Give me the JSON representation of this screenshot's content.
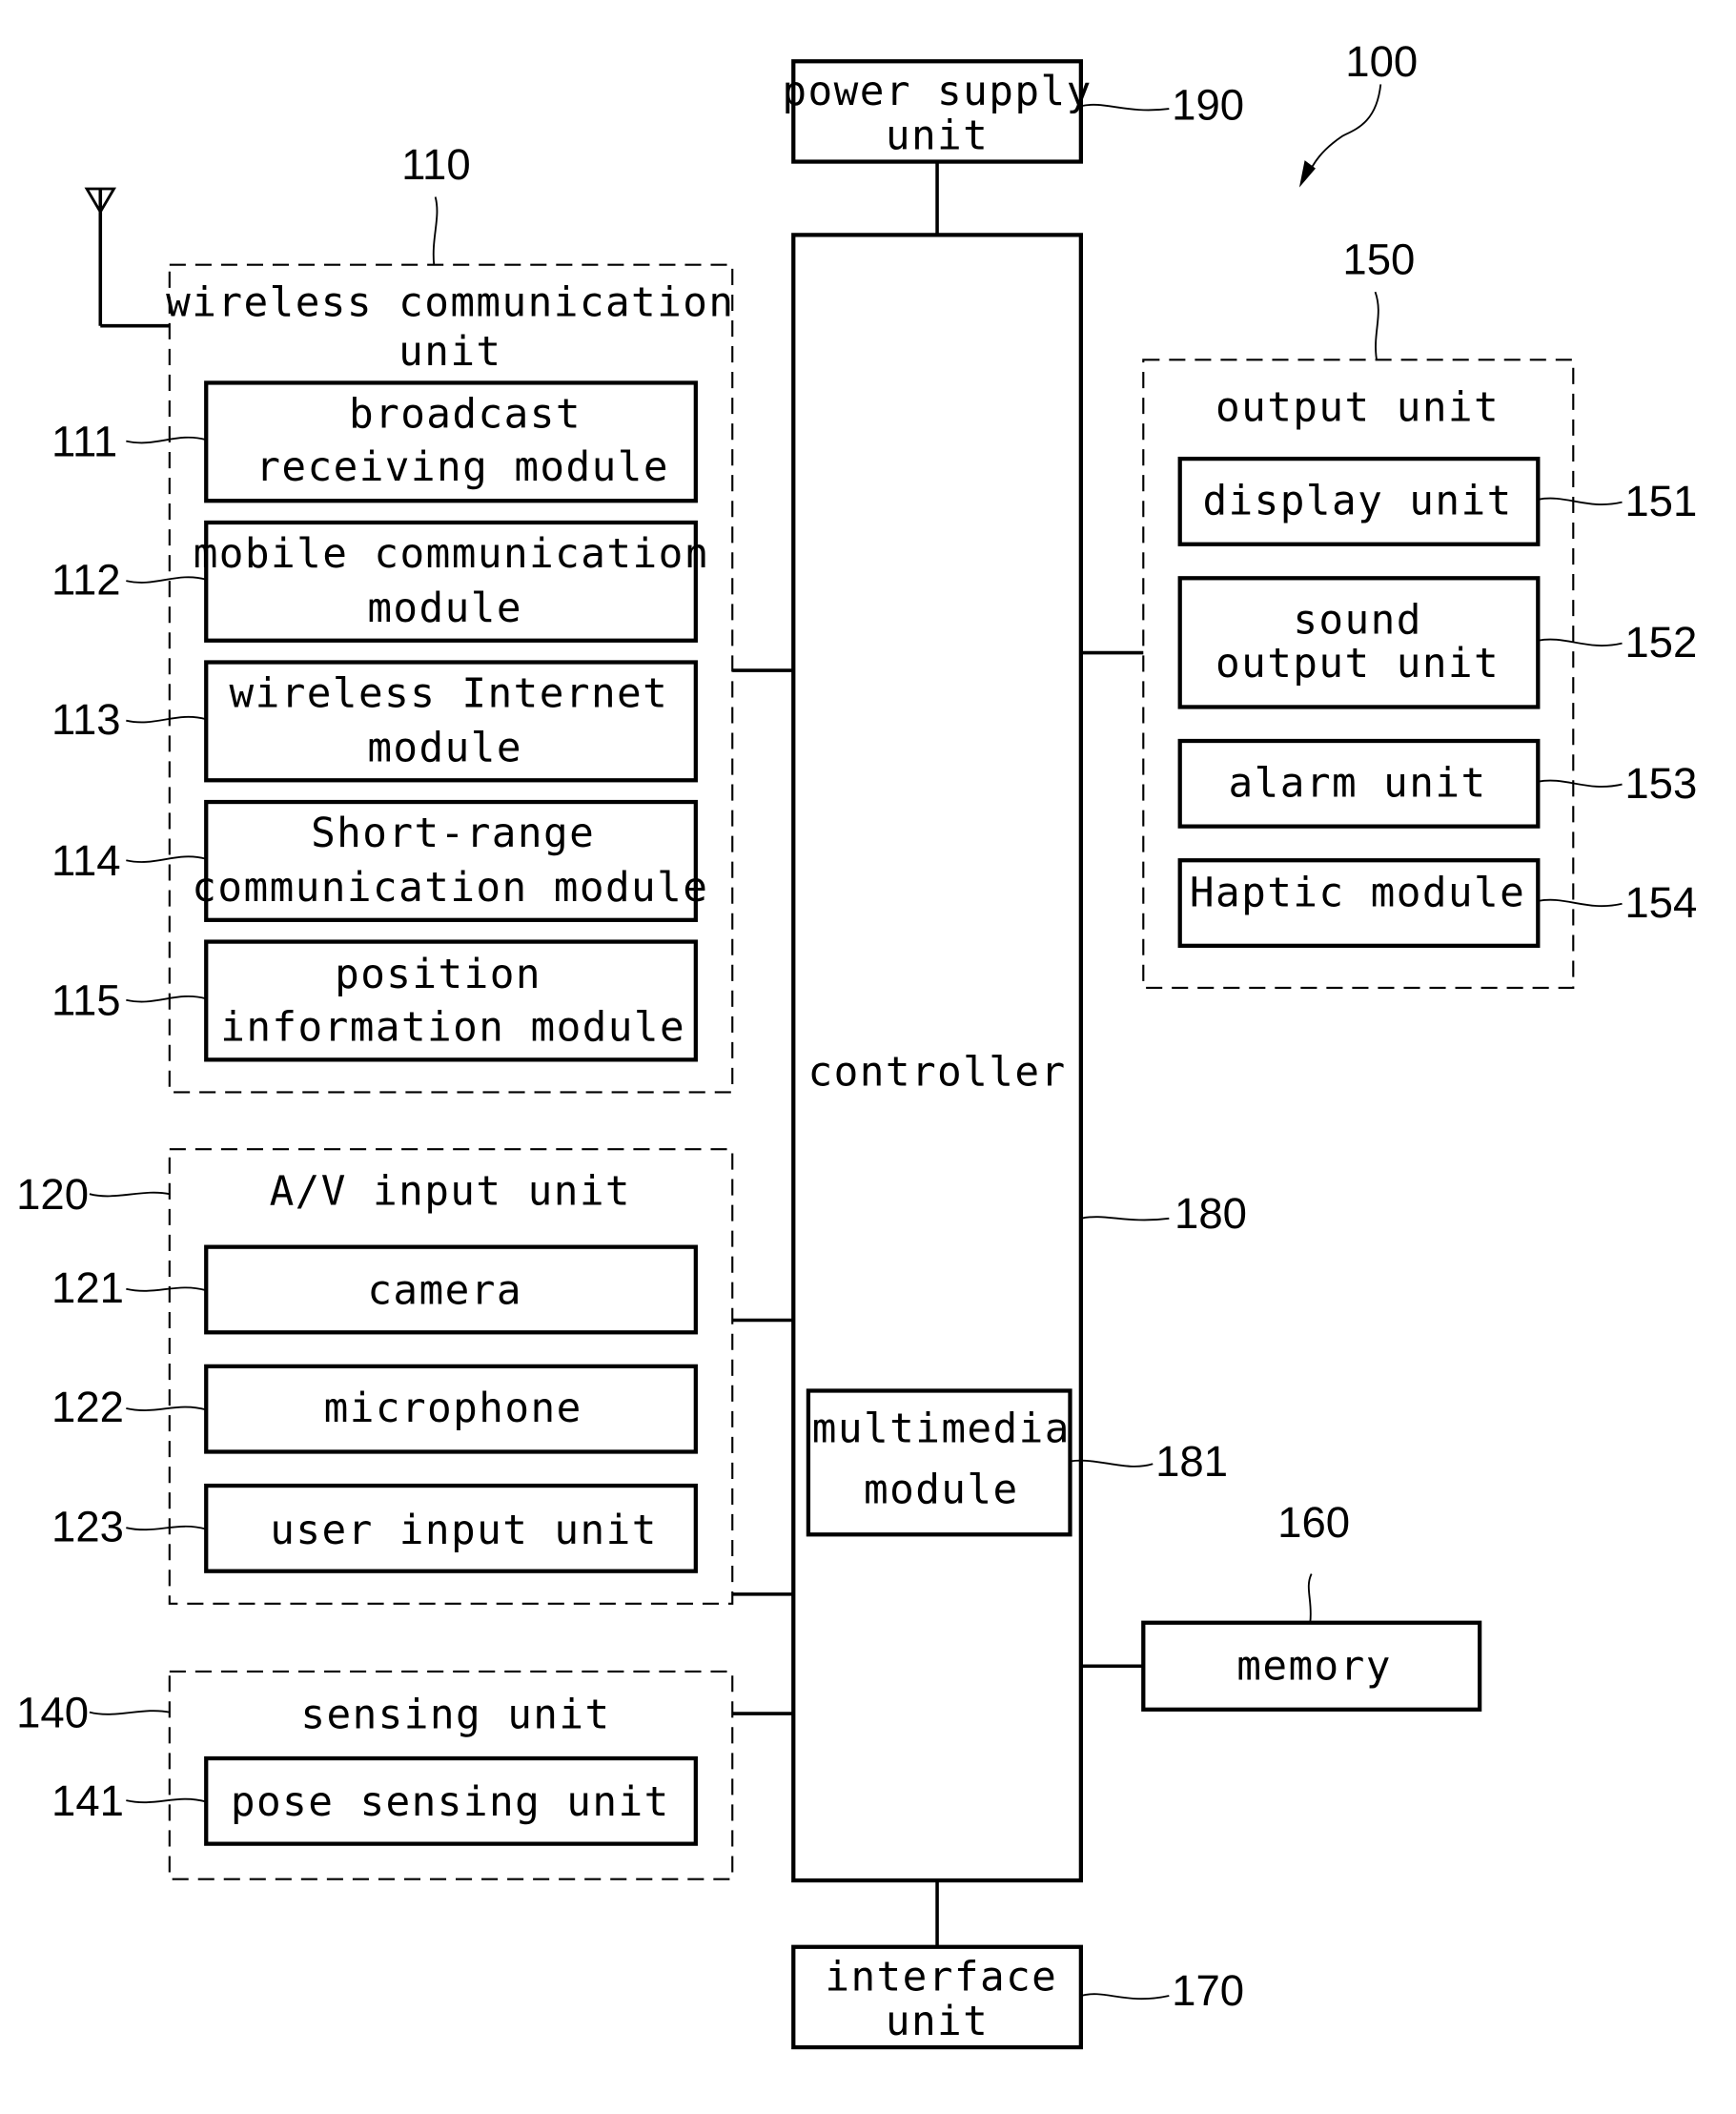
{
  "figure": {
    "ref": "100",
    "power_supply": {
      "ref": "190",
      "line1": "power supply",
      "line2": "unit"
    },
    "controller": {
      "ref": "180",
      "label": "controller"
    },
    "multimedia": {
      "ref": "181",
      "line1": "multimedia",
      "line2": "module"
    },
    "interface": {
      "ref": "170",
      "line1": "interface",
      "line2": "unit"
    },
    "memory": {
      "ref": "160",
      "label": "memory"
    },
    "wireless": {
      "ref": "110",
      "line1": "wireless communication",
      "line2": "unit",
      "modules": [
        {
          "ref": "111",
          "line1": "broadcast",
          "line2": "receiving module"
        },
        {
          "ref": "112",
          "line1": "mobile communication",
          "line2": "module"
        },
        {
          "ref": "113",
          "line1": "wireless Internet",
          "line2": "module"
        },
        {
          "ref": "114",
          "line1": "Short-range",
          "line2": "communication module"
        },
        {
          "ref": "115",
          "line1": "position",
          "line2": "information module"
        }
      ]
    },
    "av_input": {
      "ref": "120",
      "label": "A/V input unit",
      "modules": [
        {
          "ref": "121",
          "label": "camera"
        },
        {
          "ref": "122",
          "label": "microphone"
        },
        {
          "ref": "123",
          "label": "user input unit"
        }
      ]
    },
    "sensing": {
      "ref": "140",
      "label": "sensing unit",
      "modules": [
        {
          "ref": "141",
          "label": "pose sensing unit"
        }
      ]
    },
    "output": {
      "ref": "150",
      "label": "output unit",
      "modules": [
        {
          "ref": "151",
          "label": "display unit"
        },
        {
          "ref": "152",
          "line1": "sound",
          "line2": "output unit"
        },
        {
          "ref": "153",
          "label": "alarm unit"
        },
        {
          "ref": "154",
          "label": "Haptic module"
        }
      ]
    }
  }
}
